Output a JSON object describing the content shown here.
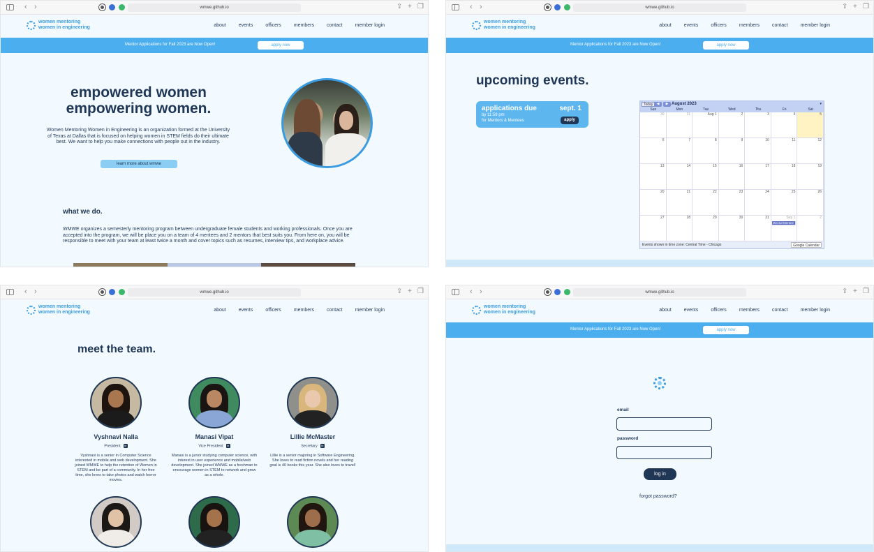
{
  "chrome": {
    "url": "wmwe.github.io"
  },
  "site": {
    "logo_line1": "women mentoring",
    "logo_line2": "women in engineering",
    "nav": [
      "about",
      "events",
      "officers",
      "members",
      "contact",
      "member login"
    ],
    "banner_text": "Mentor Applications for Fall 2023 are Now Open!",
    "banner_button": "apply now"
  },
  "home": {
    "title_line1": "empowered women",
    "title_line2": "empowering women.",
    "description": "Women Mentoring Women in Engineering is an organization formed at the University of Texas at Dallas that is focused on helping women in STEM fields do their ultimate best. We want to help you make connections with people out in the industry.",
    "learn_more": "learn more about wmwe",
    "what_title": "what we do.",
    "what_text": "WMWE organizes a semesterly mentoring program between undergraduate female students and working professionals. Once you are accepted into the program, we will be place you on a team of 4 mentees and 2 mentors that best suits you. From here on, you will be responsible to meet with your team at least twice a month and cover topics such as resumes, interview tips, and workplace advice."
  },
  "events": {
    "title": "upcoming events.",
    "card_title": "applications due",
    "card_date": "sept. 1",
    "card_time": "by 11:59 pm",
    "card_audience": "for Mentors & Mentees",
    "card_button": "apply",
    "calendar": {
      "today": "Today",
      "month": "August 2023",
      "weekdays": [
        "Sun",
        "Mon",
        "Tue",
        "Wed",
        "Thu",
        "Fri",
        "Sat"
      ],
      "days": [
        "30",
        "31",
        "Aug 1",
        "2",
        "3",
        "4",
        "5",
        "6",
        "7",
        "8",
        "9",
        "10",
        "11",
        "12",
        "13",
        "14",
        "15",
        "16",
        "17",
        "18",
        "19",
        "20",
        "21",
        "22",
        "23",
        "24",
        "25",
        "26",
        "27",
        "28",
        "29",
        "30",
        "31",
        "Sep 1",
        "2"
      ],
      "event_label": "Mentor/Mentee",
      "timezone": "Events shown in time zone: Central Time - Chicago",
      "gcal": "Google Calendar"
    }
  },
  "team": {
    "title": "meet the team.",
    "members": [
      {
        "name": "Vyshnavi Nalla",
        "role": "President",
        "bio": "Vyshnavi is a senior in Computer Science interested in mobile and web development. She joined WMWE to help the retention of Women in STEM and be part of a community. In her free time, she loves to take photos and watch horror movies."
      },
      {
        "name": "Manasi Vipat",
        "role": "Vice President",
        "bio": "Manasi is a junior studying computer science, with interest in user experience and mobile/web development. She joined WMWE as a freshman to encourage women in STEM to network and grow as a whole."
      },
      {
        "name": "Lillie McMaster",
        "role": "Secretary",
        "bio": "Lillie is a senior majoring in Software Engineering. She loves to read fiction novels and her reading goal is 40 books this year. She also loves to travel!"
      }
    ],
    "linkedin": "in"
  },
  "login": {
    "email_label": "email",
    "password_label": "password",
    "button": "log in",
    "forgot": "forgot password?"
  }
}
